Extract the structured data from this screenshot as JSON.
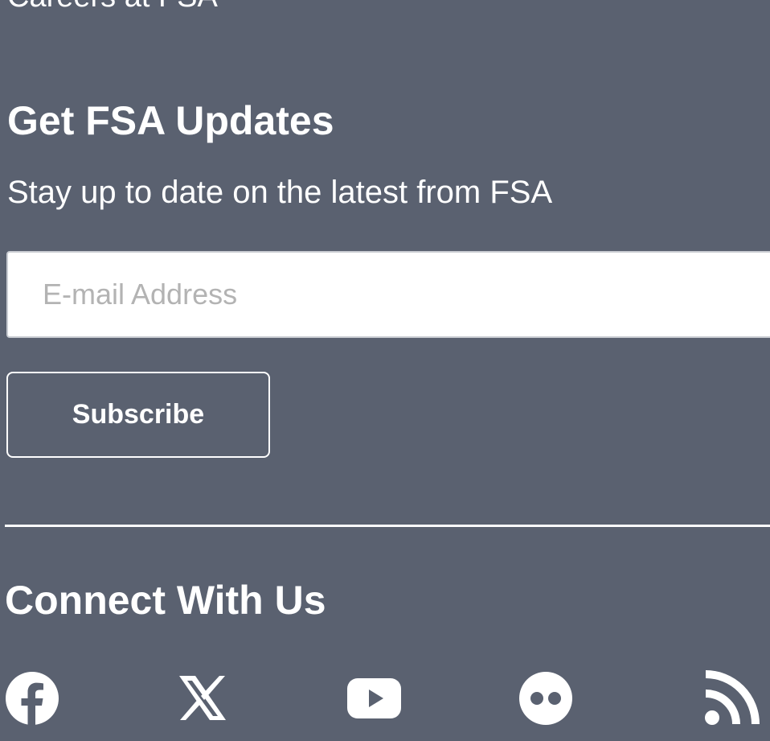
{
  "footer": {
    "careers_link": "Careers at FSA",
    "updates": {
      "heading": "Get FSA Updates",
      "subtitle": "Stay up to date on the latest from FSA",
      "email_placeholder": "E-mail Address",
      "subscribe_label": "Subscribe"
    },
    "connect": {
      "heading": "Connect With Us",
      "icons": [
        "facebook-icon",
        "x-icon",
        "youtube-icon",
        "flickr-icon",
        "rss-icon"
      ]
    }
  },
  "colors": {
    "background": "#5a6170",
    "text": "#ffffff",
    "input_background": "#ffffff",
    "placeholder": "#b3b3b3"
  }
}
